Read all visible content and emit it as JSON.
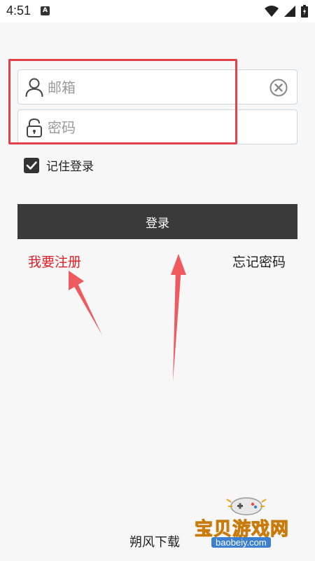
{
  "status_bar": {
    "time": "4:51",
    "notification_icon": "A"
  },
  "login_form": {
    "email_placeholder": "邮箱",
    "password_placeholder": "密码",
    "remember_label": "记住登录",
    "remember_checked": true,
    "login_button": "登录",
    "register_link": "我要注册",
    "forgot_link": "忘记密码"
  },
  "footer": {
    "app_name": "朔风下载"
  },
  "watermark": {
    "name": "宝贝游戏网",
    "url": "baobeiy.com"
  },
  "colors": {
    "annotation_red": "#e6414a",
    "register_red": "#e01f26",
    "button_dark": "#3a3a3a"
  }
}
